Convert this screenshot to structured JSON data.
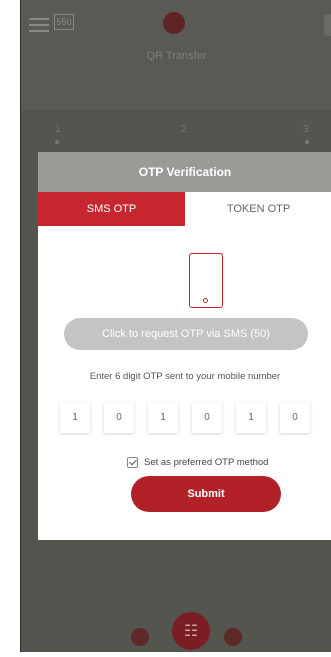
{
  "background": {
    "title": "QR Transfer",
    "badge": "550",
    "steps": [
      "1",
      "2",
      "3"
    ]
  },
  "modal": {
    "title": "OTP Verification",
    "tabs": [
      {
        "label": "SMS OTP",
        "active": true
      },
      {
        "label": "TOKEN OTP",
        "active": false
      }
    ],
    "request_button": "Click to request OTP via SMS (50)",
    "instruction": "Enter 6 digit OTP sent to your mobile number",
    "otp_digits": [
      "1",
      "0",
      "1",
      "0",
      "1",
      "0"
    ],
    "preferred_label": "Set as preferred OTP method",
    "preferred_checked": true,
    "submit_label": "Submit"
  },
  "colors": {
    "brand_red": "#c8262f",
    "submit_red": "#b22028",
    "overlay": "#55554f",
    "header_gray": "#9a9a97"
  },
  "icons": [
    "menu-icon",
    "app-logo-icon",
    "phone-icon",
    "checkbox-icon",
    "grid-icon",
    "qr-icon",
    "card-icon"
  ]
}
